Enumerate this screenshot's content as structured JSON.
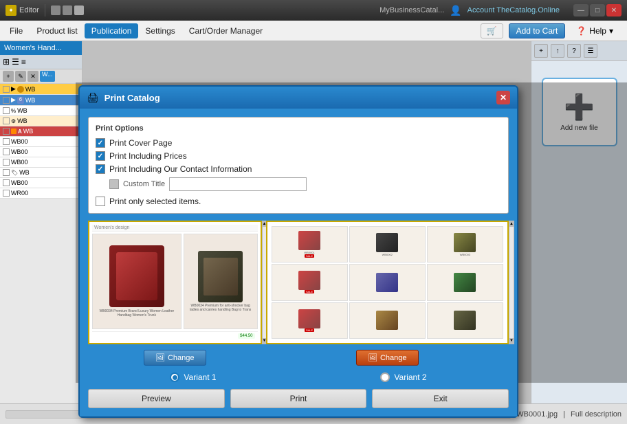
{
  "titlebar": {
    "editor_label": "Editor",
    "app_name": "MyBusinessCatal...",
    "account": "Account TheCatalog.Online",
    "controls": [
      "—",
      "□",
      "✕"
    ]
  },
  "menubar": {
    "file": "File",
    "product_list": "Product list",
    "publication": "Publication",
    "settings": "Settings",
    "cart_order": "Cart/Order Manager",
    "add_to_cart": "Add to Cart",
    "help": "Help"
  },
  "dialog": {
    "title": "Print Catalog",
    "print_options_label": "Print Options",
    "options": [
      {
        "label": "Print Cover Page",
        "checked": true
      },
      {
        "label": "Print Including Prices",
        "checked": true
      },
      {
        "label": "Print Including Our Contact Information",
        "checked": true
      }
    ],
    "custom_title_label": "Custom Title",
    "print_selected_label": "Print only selected items.",
    "variant1_label": "Variant 1",
    "variant2_label": "Variant 2",
    "change_label": "Change",
    "preview_label": "Preview",
    "print_label": "Print",
    "exit_label": "Exit"
  },
  "left_panel": {
    "header": "Women's Hand...",
    "items": [
      {
        "code": "WB...",
        "color": "#cc4444",
        "label": "WB"
      },
      {
        "code": "WB...",
        "color": "#4488cc",
        "label": "WB"
      },
      {
        "code": "WB00",
        "color": "#ffffff",
        "label": "WB00"
      },
      {
        "code": "WB00",
        "color": "#ffffff",
        "label": "WB00"
      },
      {
        "code": "WB00",
        "color": "#ffffff",
        "label": "WB00"
      },
      {
        "code": "WB00",
        "color": "#ffffff",
        "label": "WB00"
      },
      {
        "code": "WR00",
        "color": "#ffffff",
        "label": "WR00"
      }
    ]
  },
  "right_panel": {
    "add_new_file_label": "Add new file",
    "toolbar_buttons": [
      "+",
      "↑",
      "?",
      "☰"
    ]
  },
  "status_bar": {
    "filename": "WB0001.jpg",
    "full_desc": "Full description"
  },
  "icons": {
    "print": "🖨",
    "close": "✕",
    "change": "🖼",
    "preview": "👁",
    "cart": "🛒",
    "plus": "+",
    "arrow_up": "▲",
    "question": "?",
    "menu": "☰"
  }
}
